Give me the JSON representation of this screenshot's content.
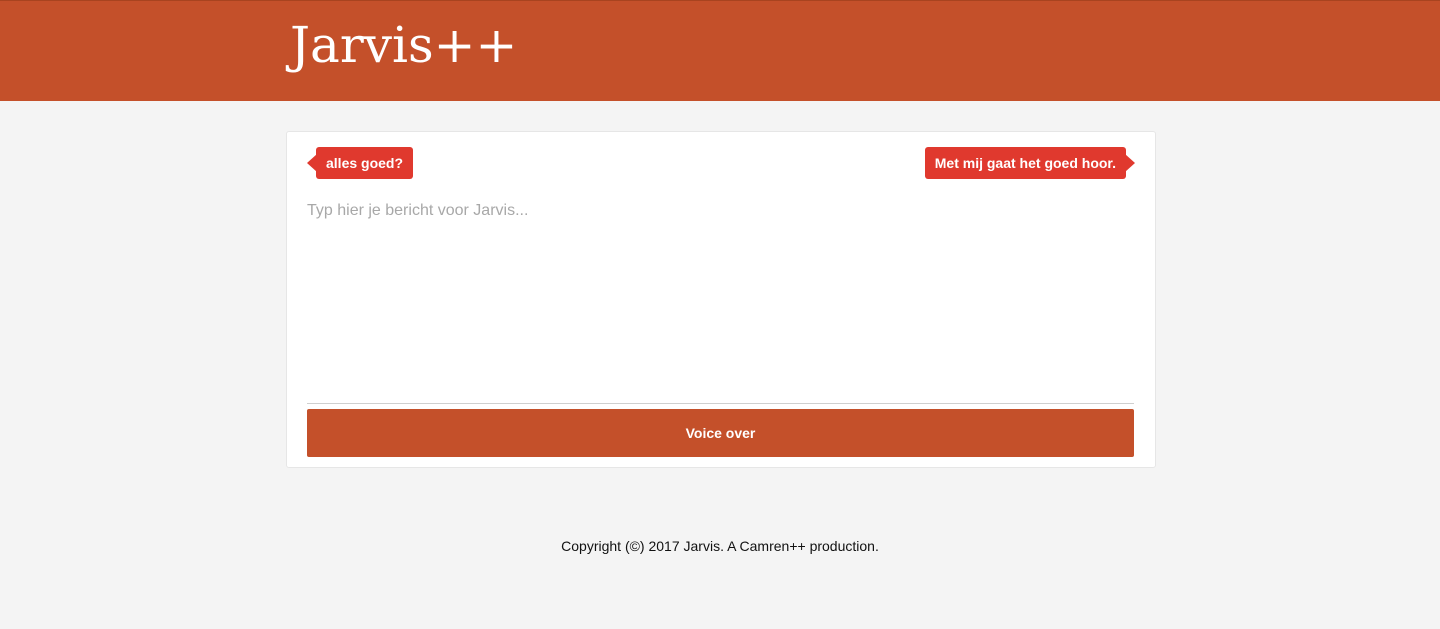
{
  "header": {
    "brand": "Jarvis++"
  },
  "chat": {
    "user_message": "alles goed?",
    "bot_message": "Met mij gaat het goed hoor.",
    "input_placeholder": "Typ hier je bericht voor Jarvis...",
    "input_value": "",
    "voice_button_label": "Voice over"
  },
  "footer": {
    "copyright": "Copyright (©) 2017 Jarvis. A Camren++ production."
  },
  "colors": {
    "primary": "#c4502a",
    "tag": "#e0392e",
    "background": "#f4f4f4"
  }
}
